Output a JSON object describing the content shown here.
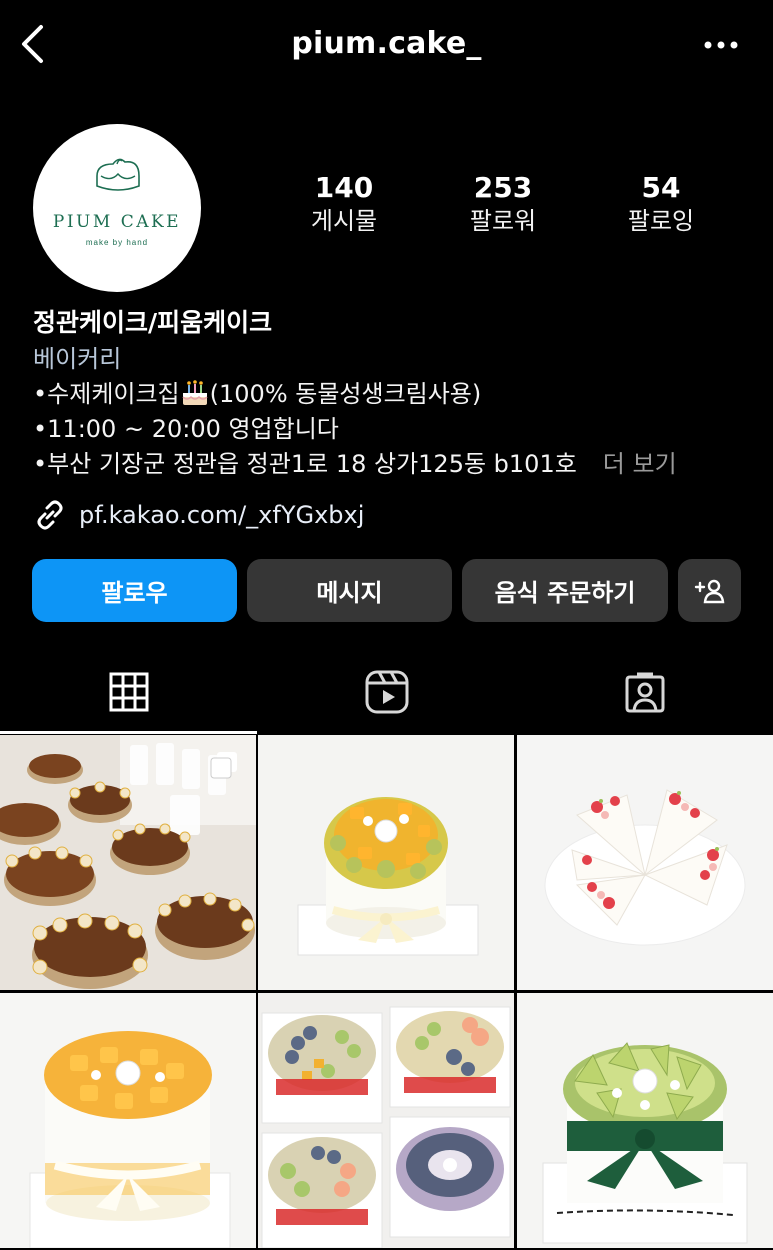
{
  "header": {
    "username": "pium.cake_",
    "back_icon": "chevron-left-icon",
    "more_icon": "ellipsis-icon"
  },
  "profile": {
    "avatar": {
      "brand": "PIUM CAKE",
      "tagline": "make by hand"
    },
    "stats": [
      {
        "value": "140",
        "label": "게시물"
      },
      {
        "value": "253",
        "label": "팔로워"
      },
      {
        "value": "54",
        "label": "팔로잉"
      }
    ],
    "bio": {
      "name": "정관케이크/피움케이크",
      "category": "베이커리",
      "line1_before": "•수제케이크집",
      "line1_after": "(100% 동물성생크림사용)",
      "line2": "•11:00 ~ 20:00 영업합니다",
      "line3": "•부산 기장군 정관읍 정관1로 18 상가125동 b101호",
      "more": "더 보기"
    },
    "link": "pf.kakao.com/_xfYGxbxj"
  },
  "actions": {
    "follow": "팔로우",
    "message": "메시지",
    "order": "음식 주문하기"
  },
  "tabs": [
    {
      "icon": "grid-icon",
      "active": true
    },
    {
      "icon": "reels-icon",
      "active": false
    },
    {
      "icon": "tagged-icon",
      "active": false
    }
  ],
  "colors": {
    "background": "#000000",
    "follow_button": "#0d95f6",
    "secondary_button": "#363636",
    "category_text": "#b8c7d9",
    "brand_green": "#1d6e52"
  },
  "posts": [
    {
      "icon": "chocolate-cakes-photo"
    },
    {
      "icon": "fruit-cake-photo"
    },
    {
      "icon": "strawberry-cake-slices-photo"
    },
    {
      "icon": "mango-cake-photo"
    },
    {
      "icon": "mixed-fruit-cakes-photo"
    },
    {
      "icon": "melon-cake-photo"
    }
  ]
}
